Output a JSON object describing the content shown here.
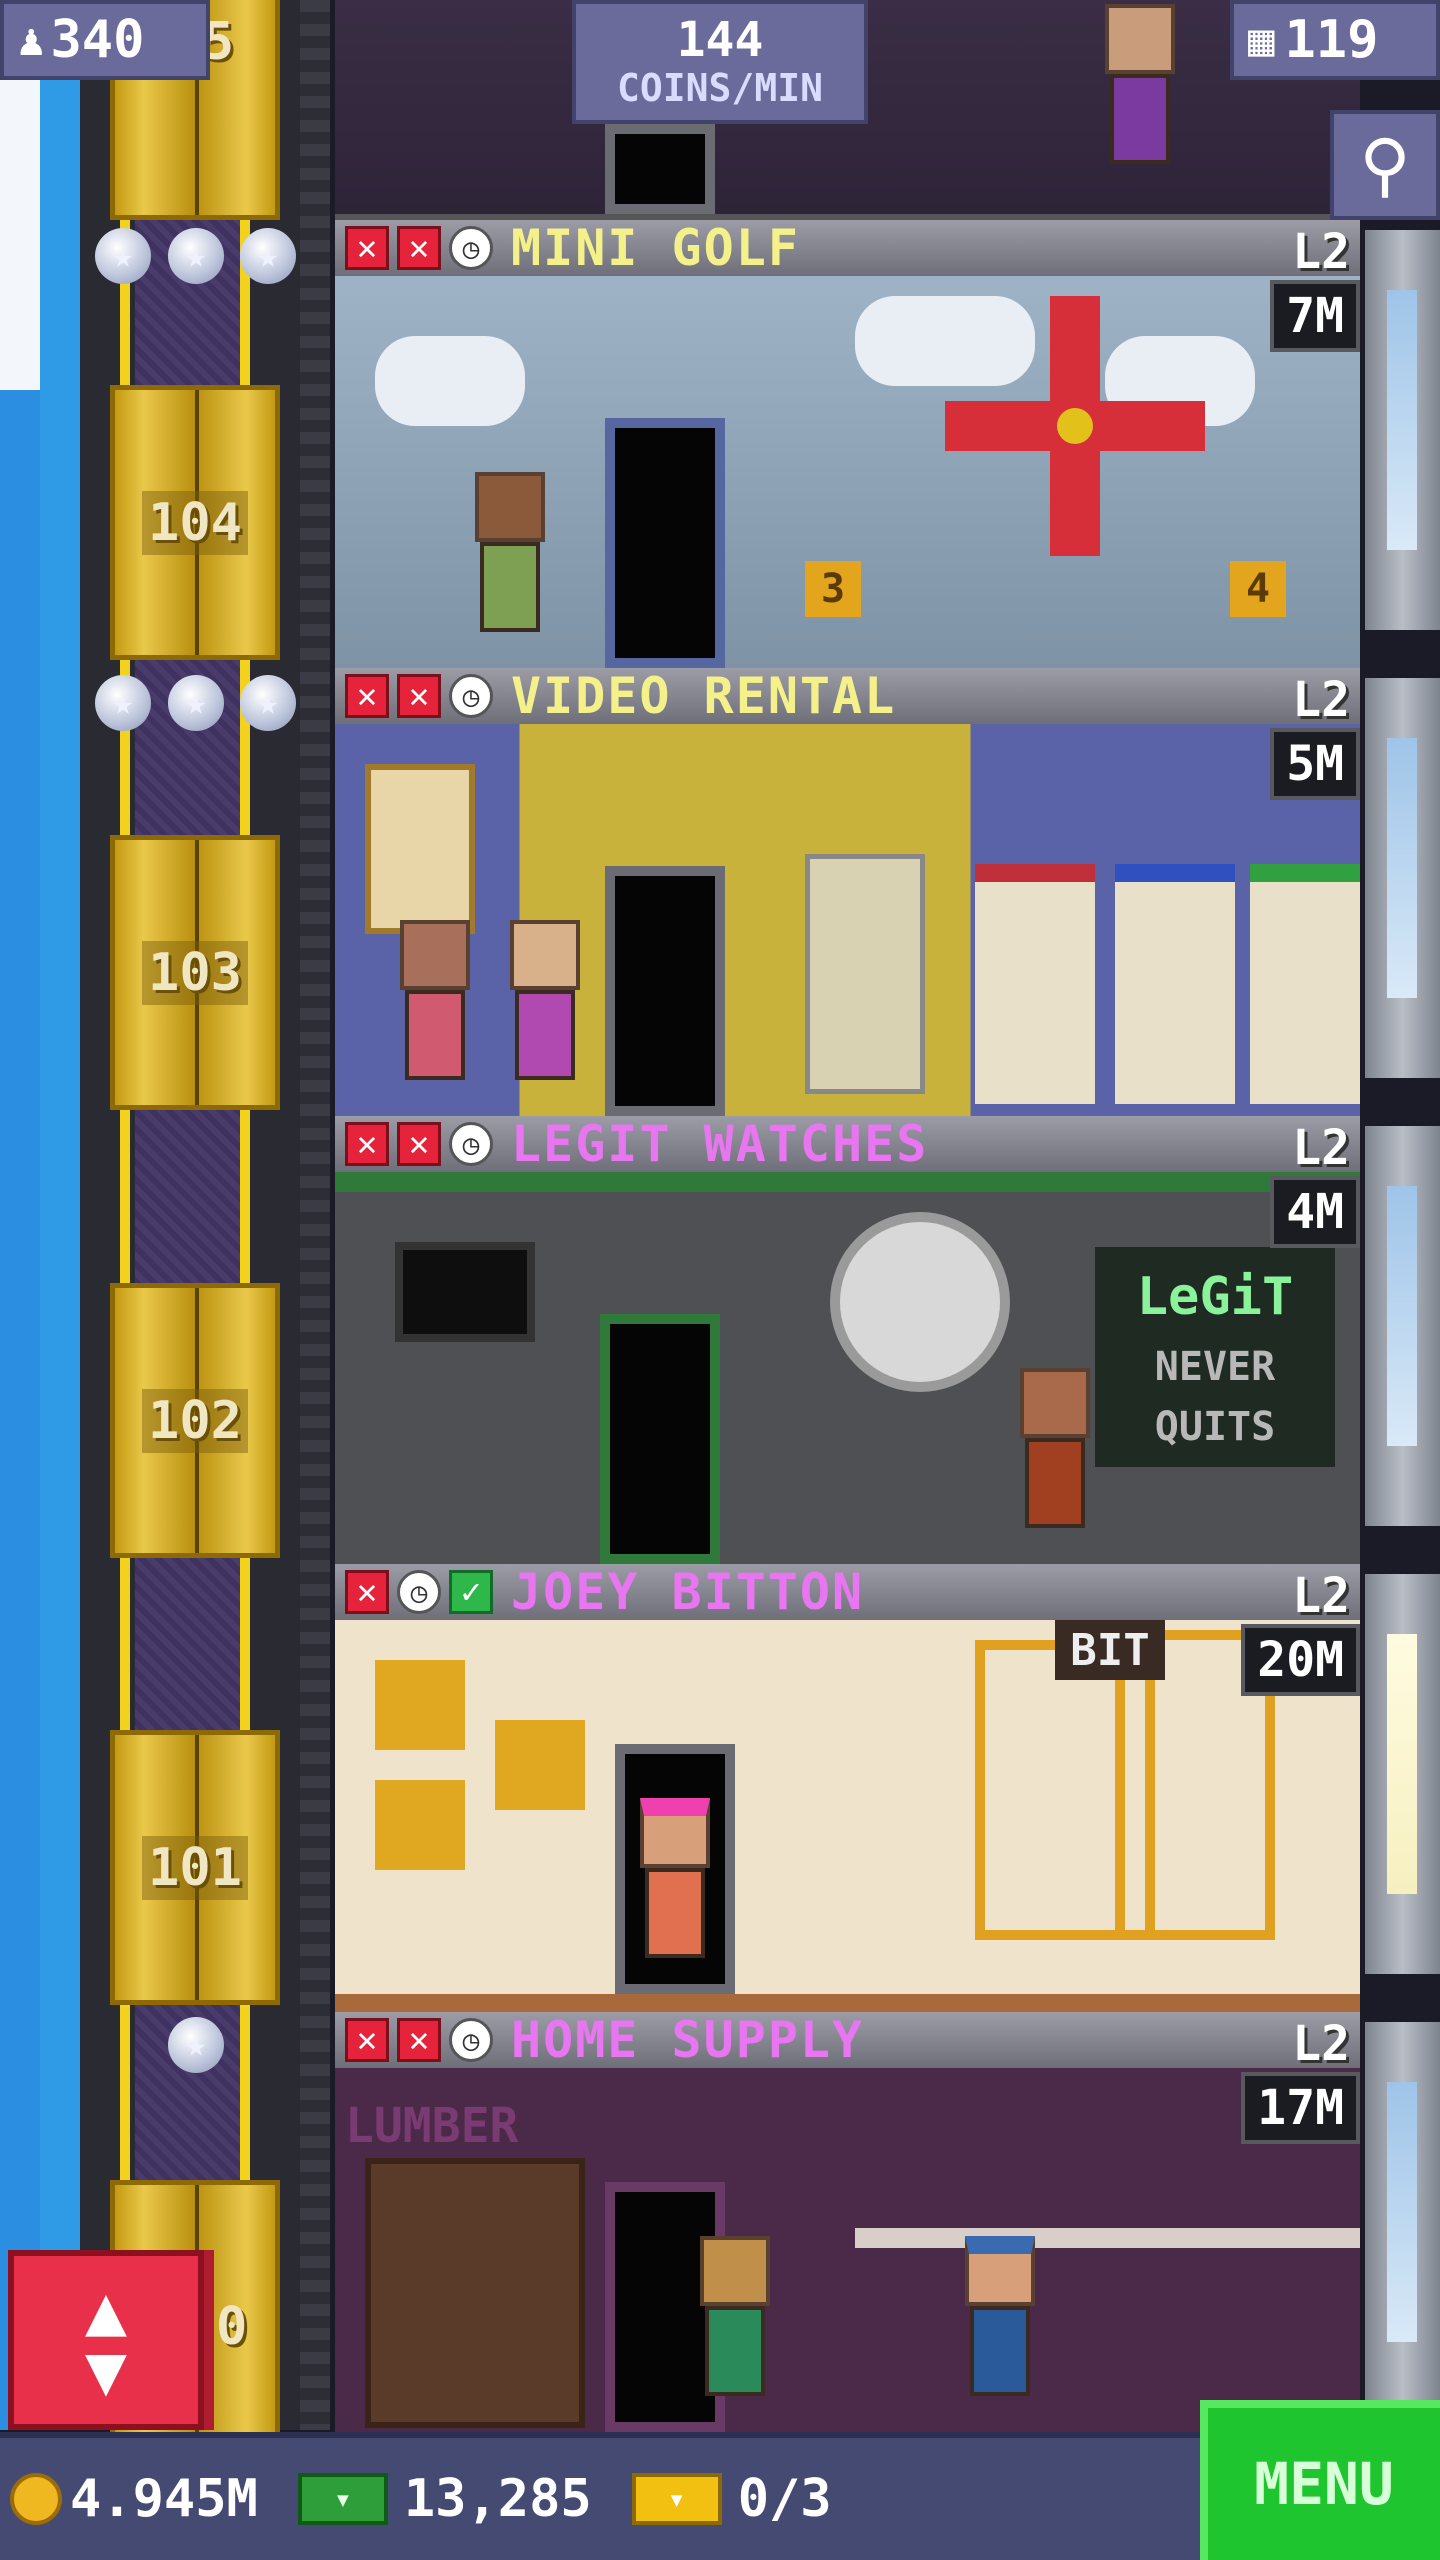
{
  "hud": {
    "population": "340",
    "coins_per_min_value": "144",
    "coins_per_min_unit": "COINS/MIN",
    "floors_count": "119"
  },
  "elevator": {
    "floor_labels": [
      "5",
      "104",
      "103",
      "102",
      "101",
      "0"
    ]
  },
  "floors": [
    {
      "name": "MINI GOLF",
      "level": "L2",
      "stock": "7M",
      "name_color": "#f4f08a",
      "status": [
        "x",
        "x",
        "clock"
      ],
      "signs": [
        "3",
        "4"
      ]
    },
    {
      "name": "VIDEO RENTAL",
      "level": "L2",
      "stock": "5M",
      "name_color": "#f4f08a",
      "status": [
        "x",
        "x",
        "clock"
      ]
    },
    {
      "name": "LEGIT WATCHES",
      "level": "L2",
      "stock": "4M",
      "name_color": "#e776f0",
      "status": [
        "x",
        "x",
        "clock"
      ],
      "signs": [
        "LeGiT",
        "NEVER",
        "QUITS"
      ]
    },
    {
      "name": "JOEY BITTON",
      "level": "L2",
      "stock": "20M",
      "name_color": "#e776f0",
      "status": [
        "x",
        "clock",
        "check"
      ],
      "signs": [
        "BIT"
      ]
    },
    {
      "name": "HOME SUPPLY",
      "level": "L2",
      "stock": "17M",
      "name_color": "#e776f0",
      "status": [
        "x",
        "x",
        "clock"
      ],
      "signs": [
        "LUMBER"
      ]
    }
  ],
  "bottom": {
    "coins": "4.945M",
    "bux": "13,285",
    "tickets": "0/3",
    "menu_label": "MENU"
  },
  "colors": {
    "accent_green": "#1fc52e",
    "badge_purple": "#6a6b9a",
    "elevator_red": "#e8304a"
  }
}
